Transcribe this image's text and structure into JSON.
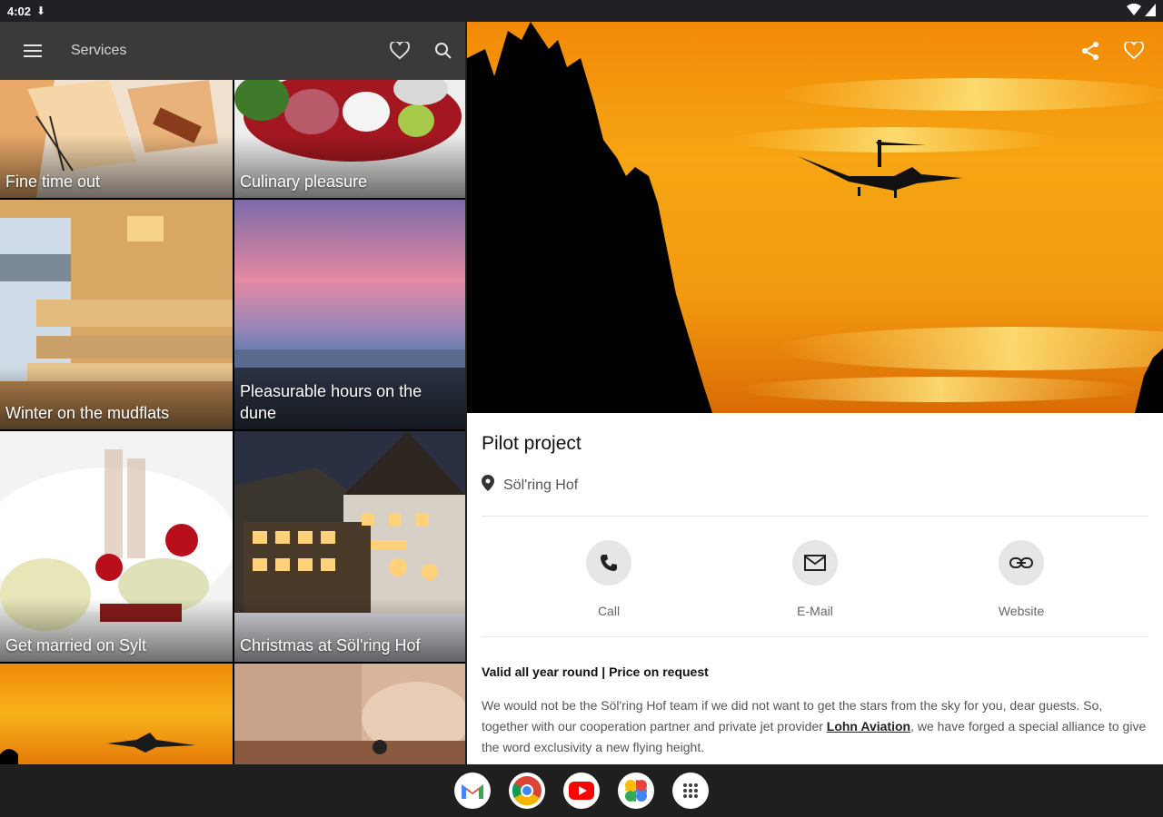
{
  "status": {
    "time": "4:02"
  },
  "appbar": {
    "title": "Services"
  },
  "tiles": [
    {
      "label": "Fine time out"
    },
    {
      "label": "Culinary pleasure"
    },
    {
      "label": "Winter on the mudflats"
    },
    {
      "label": "Pleasurable hours on the dune"
    },
    {
      "label": "Get married on Sylt"
    },
    {
      "label": "Christmas at Söl'ring Hof"
    },
    {
      "label": ""
    },
    {
      "label": ""
    }
  ],
  "detail": {
    "title": "Pilot project",
    "location": "Söl'ring Hof",
    "contacts": {
      "call": "Call",
      "email": "E-Mail",
      "website": "Website"
    },
    "valid": "Valid all year round | Price on request",
    "desc_before": "We would not be the Söl'ring Hof team if we did not want to get the stars from the sky for you, dear guests. So, together with our cooperation partner and private jet provider ",
    "desc_link": "Lohn Aviation",
    "desc_after": ", we have forged a special alliance to give the word exclusivity a new flying height."
  },
  "taskbar": [
    "gmail-icon",
    "chrome-icon",
    "youtube-icon",
    "photos-icon",
    "apps-grid-icon"
  ],
  "colors": {
    "appbar": "#3a3a3a",
    "accent_sky": "#f59a12"
  }
}
